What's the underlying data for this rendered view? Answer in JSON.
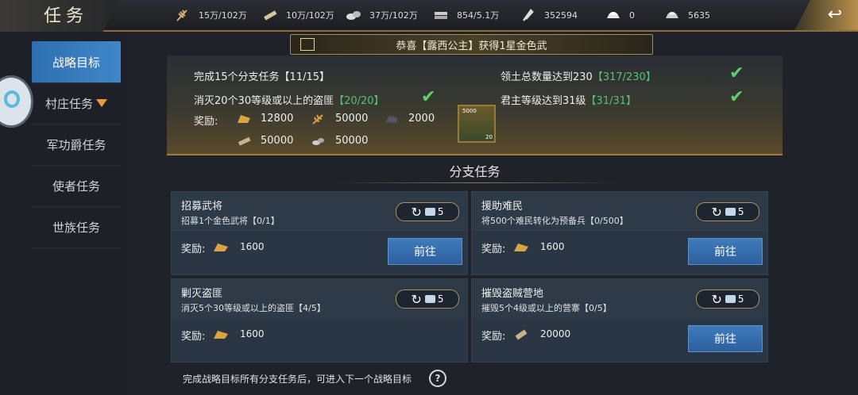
{
  "header": {
    "title": "任务",
    "resources": [
      {
        "icon": "wheat-icon",
        "value": "15万/102万"
      },
      {
        "icon": "wood-log-icon",
        "value": "10万/102万"
      },
      {
        "icon": "stone-icon",
        "value": "37万/102万"
      },
      {
        "icon": "iron-ingot-icon",
        "value": "854/5.1万"
      },
      {
        "icon": "copper-coin-icon",
        "value": "352594"
      },
      {
        "icon": "gold-ingot-icon",
        "value": "0"
      },
      {
        "icon": "silver-ingot-icon",
        "value": "5635"
      }
    ]
  },
  "sidebar": {
    "tabs": [
      {
        "label": "战略目标",
        "active": true
      },
      {
        "label": "村庄任务",
        "active": false,
        "dropdown": true
      },
      {
        "label": "军功爵任务",
        "active": false
      },
      {
        "label": "使者任务",
        "active": false
      },
      {
        "label": "世族任务",
        "active": false
      }
    ]
  },
  "banner": {
    "text": "恭喜【露西公主】获得1星金色武"
  },
  "strategic_goal": {
    "objectives": [
      {
        "text": "完成15个分支任务",
        "progress": "【11/15】",
        "done": false
      },
      {
        "text": "领土总数量达到230",
        "progress": "【317/230】",
        "done": true
      },
      {
        "text": "消灭20个30等级或以上的盗匪",
        "progress": "【20/20】",
        "done": true
      },
      {
        "text": "君主等级达到31级",
        "progress": "【31/31】",
        "done": true
      }
    ],
    "reward_label": "奖励:",
    "rewards": [
      {
        "icon": "gold-ingot-icon",
        "value": "12800"
      },
      {
        "icon": "wheat-icon",
        "value": "50000"
      },
      {
        "icon": "iron-ore-icon",
        "value": "2000"
      },
      {
        "icon": "wood-log-icon",
        "value": "50000"
      },
      {
        "icon": "stone-icon",
        "value": "50000"
      }
    ],
    "chest": {
      "top": "5000",
      "count": "20"
    }
  },
  "branch": {
    "section_title": "分支任务",
    "tasks": [
      {
        "title": "招募武将",
        "desc": "招募1个金色武将【0/1】",
        "refresh_cost": "5",
        "reward_label": "奖励:",
        "reward_icon": "gold-ingot-icon",
        "reward_value": "1600",
        "go": ""
      },
      {
        "title": "援助难民",
        "desc": "将500个难民转化为预备兵【0/500】",
        "refresh_cost": "5",
        "reward_label": "奖励:",
        "reward_icon": "gold-ingot-icon",
        "reward_value": "1600",
        "go": "前往"
      },
      {
        "title": "剿灭盗匪",
        "desc": "消灭5个30等级或以上的盗匪【4/5】",
        "refresh_cost": "5",
        "reward_label": "奖励:",
        "reward_icon": "gold-ingot-icon",
        "reward_value": "1600",
        "go": ""
      },
      {
        "title": "摧毁盗贼营地",
        "desc": "摧毁5个4级或以上的营寨【0/5】",
        "refresh_cost": "5",
        "reward_label": "奖励:",
        "reward_icon": "wood-log-icon",
        "reward_value": "20000",
        "go": "前往"
      }
    ],
    "go_label_first": "前往"
  },
  "footer": {
    "note": "完成战略目标所有分支任务后，可进入下一个战略目标",
    "help": "?"
  }
}
